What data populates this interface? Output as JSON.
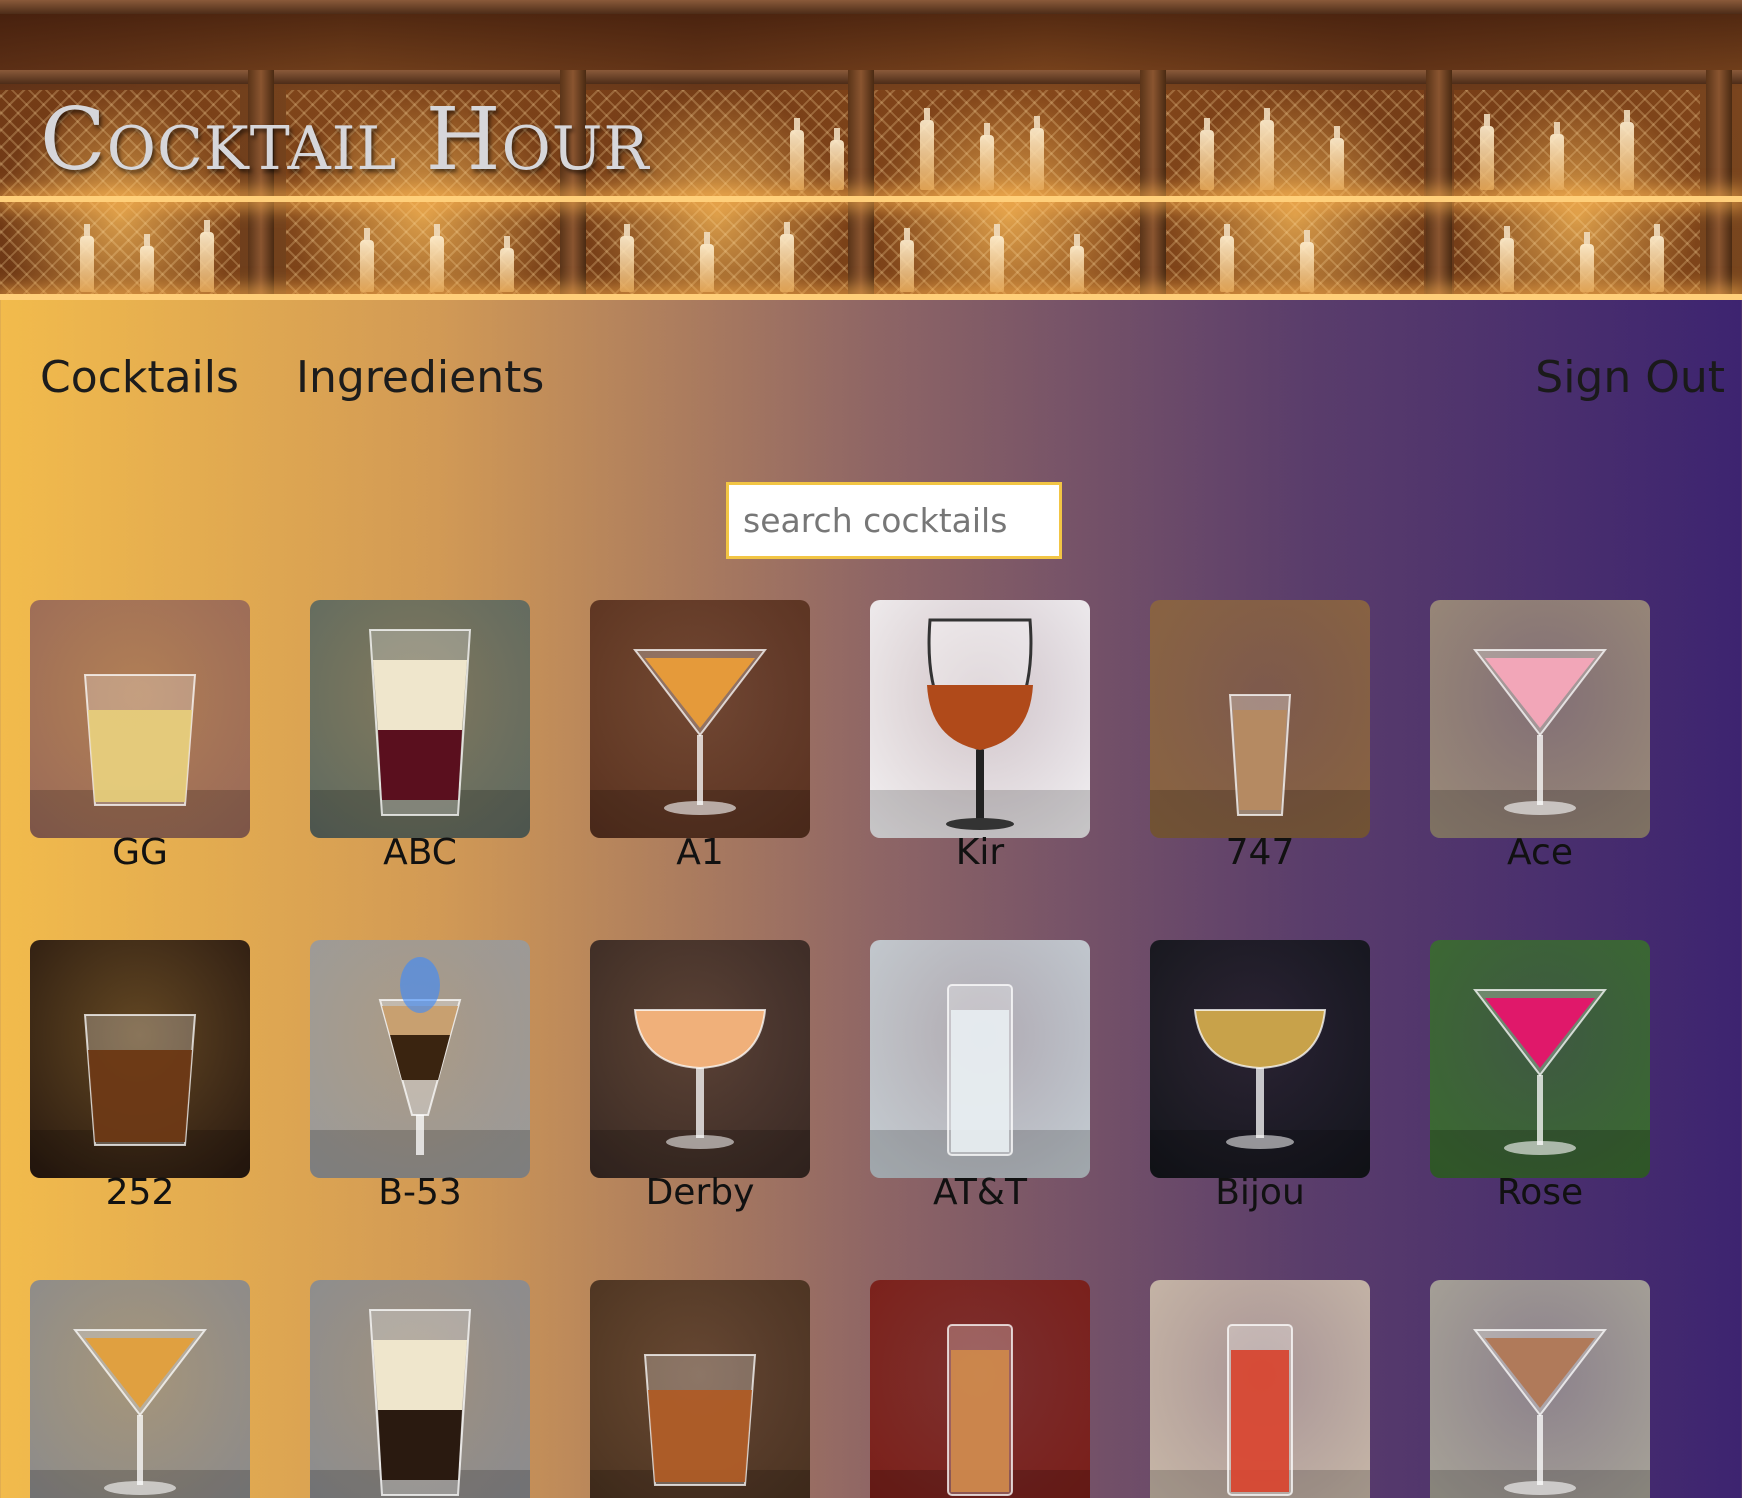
{
  "header": {
    "site_title": "Cocktail Hour"
  },
  "nav": {
    "cocktails_label": "Cocktails",
    "ingredients_label": "Ingredients",
    "sign_out_label": "Sign Out"
  },
  "search": {
    "placeholder": "search cocktails",
    "value": ""
  },
  "colors": {
    "search_border": "#f2c544",
    "gradient_left": "#f2bb4c",
    "gradient_right": "#3d2470"
  },
  "cocktails": [
    {
      "name": "GG",
      "bg": "#9a6a58",
      "glass": "rocks",
      "drink": "#e8cf7a"
    },
    {
      "name": "ABC",
      "bg": "#5f6a60",
      "glass": "shot-layered",
      "drink": "#5a0f1e"
    },
    {
      "name": "A1",
      "bg": "#5a3220",
      "glass": "martini",
      "drink": "#e59a3a"
    },
    {
      "name": "Kir",
      "bg": "#f2f0f2",
      "glass": "wine",
      "drink": "#b04a1a"
    },
    {
      "name": "747",
      "bg": "#8a6440",
      "glass": "shot",
      "drink": "#b58a62"
    },
    {
      "name": "Ace",
      "bg": "#9a8a78",
      "glass": "martini",
      "drink": "#f2a6b8"
    },
    {
      "name": "252",
      "bg": "#2a1a10",
      "glass": "rocks",
      "drink": "#6a3410"
    },
    {
      "name": "B-53",
      "bg": "#9a9a9a",
      "glass": "pousse",
      "drink": "#3a2410"
    },
    {
      "name": "Derby",
      "bg": "#3a2a24",
      "glass": "coupe",
      "drink": "#f0b07a"
    },
    {
      "name": "AT&T",
      "bg": "#c4ccd2",
      "glass": "highball",
      "drink": "#e8eef2"
    },
    {
      "name": "Bijou",
      "bg": "#14161c",
      "glass": "coupe",
      "drink": "#c8a24a"
    },
    {
      "name": "Rose",
      "bg": "#3a6a30",
      "glass": "martini",
      "drink": "#e0186a"
    },
    {
      "name": "",
      "bg": "#8a8a8c",
      "glass": "martini",
      "drink": "#e0a040"
    },
    {
      "name": "",
      "bg": "#8a8c90",
      "glass": "shot-layered",
      "drink": "#2a1a10"
    },
    {
      "name": "",
      "bg": "#4a3220",
      "glass": "rocks",
      "drink": "#b05a22"
    },
    {
      "name": "",
      "bg": "#7a1e18",
      "glass": "highball",
      "drink": "#d08a4a"
    },
    {
      "name": "",
      "bg": "#c8b8a8",
      "glass": "highball",
      "drink": "#d8402a"
    },
    {
      "name": "",
      "bg": "#a8a498",
      "glass": "martini",
      "drink": "#b07a5a"
    }
  ]
}
